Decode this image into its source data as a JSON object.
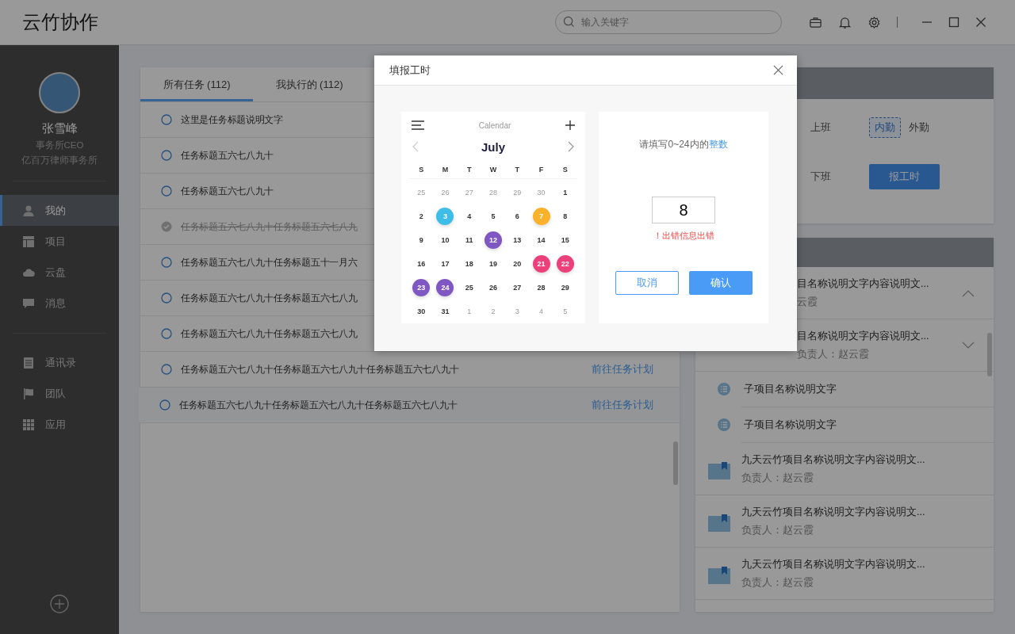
{
  "app": {
    "logo": "云竹协作",
    "search": {
      "placeholder": "输入关键字"
    }
  },
  "sidebar": {
    "user": {
      "name": "张雪峰",
      "role": "事务所CEO",
      "company": "亿百万律师事务所"
    },
    "nav_groups": [
      [
        {
          "label": "我的",
          "selected": true
        },
        {
          "label": "项目",
          "selected": false
        },
        {
          "label": "云盘",
          "selected": false
        },
        {
          "label": "消息",
          "selected": false
        }
      ],
      [
        {
          "label": "通讯录",
          "selected": false
        },
        {
          "label": "团队",
          "selected": false
        },
        {
          "label": "应用",
          "selected": false
        }
      ]
    ]
  },
  "tasks": {
    "tabs": [
      {
        "label": "所有任务 (112)",
        "selected": true
      },
      {
        "label": "我执行的 (112)",
        "selected": false
      }
    ],
    "rows": [
      {
        "title": "这里是任务标题说明文字",
        "done": false,
        "selected": false
      },
      {
        "title": "任务标题五六七八九十",
        "done": false,
        "selected": false
      },
      {
        "title": "任务标题五六七八九十",
        "done": false,
        "selected": false
      },
      {
        "title": "任务标题五六七八九十任务标题五六七八九",
        "done": true,
        "selected": false
      },
      {
        "title": "任务标题五六七八九十任务标题五十一月六",
        "done": false,
        "selected": false
      },
      {
        "title": "任务标题五六七八九十任务标题五六七八九",
        "done": false,
        "selected": false
      },
      {
        "title": "任务标题五六七八九十任务标题五六七八九",
        "done": false,
        "selected": false
      },
      {
        "title": "任务标题五六七八九十任务标题五六七八九十任务标题五六七八九十",
        "done": false,
        "selected": false,
        "link": "前往任务计划"
      },
      {
        "title": "任务标题五六七八九十任务标题五六七八九十任务标题五六七八九十",
        "done": false,
        "selected": true,
        "link": "前往任务计划"
      }
    ]
  },
  "attendance": {
    "rows": [
      {
        "kind": "options",
        "label": "上班",
        "options": [
          {
            "label": "内勤",
            "selected": true
          },
          {
            "label": "外勤",
            "selected": false
          }
        ]
      },
      {
        "kind": "button",
        "label": "下班",
        "button": "报工时"
      }
    ]
  },
  "projects": {
    "items": [
      {
        "kind": "partial",
        "title": "目名称说明文字内容说明文...",
        "owner": "云霞",
        "expanded": true
      },
      {
        "kind": "partial",
        "title": "目名称说明文字内容说明文...",
        "owner": "负责人：赵云霞",
        "expanded": false
      },
      {
        "kind": "sub",
        "title": "子项目名称说明文字"
      },
      {
        "kind": "sub",
        "title": "子项目名称说明文字"
      },
      {
        "kind": "project",
        "title": "九天云竹项目名称说明文字内容说明文...",
        "owner": "负责人：赵云霞"
      },
      {
        "kind": "project",
        "title": "九天云竹项目名称说明文字内容说明文...",
        "owner": "负责人：赵云霞"
      },
      {
        "kind": "project",
        "title": "九天云竹项目名称说明文字内容说明文...",
        "owner": "负责人：赵云霞"
      }
    ]
  },
  "dialog": {
    "title": "填报工时",
    "calendar": {
      "title": "Calendar",
      "month": "July",
      "weekdays": [
        "S",
        "M",
        "T",
        "W",
        "T",
        "F",
        "S"
      ],
      "days": [
        {
          "day": "25",
          "muted": true
        },
        {
          "day": "26",
          "muted": true
        },
        {
          "day": "27",
          "muted": true
        },
        {
          "day": "28",
          "muted": true
        },
        {
          "day": "29",
          "muted": true
        },
        {
          "day": "30",
          "muted": true
        },
        {
          "day": "1",
          "muted": false
        },
        {
          "day": "2",
          "muted": false
        },
        {
          "day": "3",
          "muted": false,
          "color": "#3ebde9"
        },
        {
          "day": "4",
          "muted": false
        },
        {
          "day": "5",
          "muted": false
        },
        {
          "day": "6",
          "muted": false
        },
        {
          "day": "7",
          "muted": false,
          "color": "#fbb12a"
        },
        {
          "day": "8",
          "muted": false
        },
        {
          "day": "9",
          "muted": false
        },
        {
          "day": "10",
          "muted": false
        },
        {
          "day": "11",
          "muted": false
        },
        {
          "day": "12",
          "muted": false,
          "color": "#7e57c2"
        },
        {
          "day": "13",
          "muted": false
        },
        {
          "day": "14",
          "muted": false
        },
        {
          "day": "15",
          "muted": false
        },
        {
          "day": "16",
          "muted": false
        },
        {
          "day": "17",
          "muted": false
        },
        {
          "day": "18",
          "muted": false
        },
        {
          "day": "19",
          "muted": false
        },
        {
          "day": "20",
          "muted": false
        },
        {
          "day": "21",
          "muted": false,
          "color": "#ec407a"
        },
        {
          "day": "22",
          "muted": false,
          "color": "#ec407a"
        },
        {
          "day": "23",
          "muted": false,
          "color": "#7e57c2"
        },
        {
          "day": "24",
          "muted": false,
          "color": "#7e57c2"
        },
        {
          "day": "25",
          "muted": false
        },
        {
          "day": "26",
          "muted": false
        },
        {
          "day": "27",
          "muted": false
        },
        {
          "day": "28",
          "muted": false
        },
        {
          "day": "29",
          "muted": false
        },
        {
          "day": "30",
          "muted": false
        },
        {
          "day": "31",
          "muted": false
        },
        {
          "day": "1",
          "muted": true
        },
        {
          "day": "2",
          "muted": true
        },
        {
          "day": "3",
          "muted": true
        },
        {
          "day": "4",
          "muted": true
        },
        {
          "day": "5",
          "muted": true
        }
      ]
    },
    "form": {
      "hint": "请填写0~24内的",
      "hint_link": "整数",
      "value": "8",
      "error": "！出错信息出错",
      "buttons": [
        {
          "kind": "secondary",
          "label": "取消"
        },
        {
          "kind": "primary",
          "label": "确认"
        }
      ]
    }
  }
}
